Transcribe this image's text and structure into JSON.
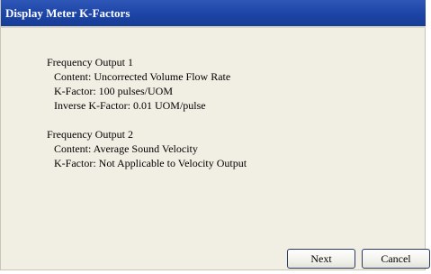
{
  "dialog": {
    "title": "Display Meter K-Factors"
  },
  "outputs": [
    {
      "heading": "Frequency Output 1",
      "lines": [
        "Content: Uncorrected Volume Flow Rate",
        "K-Factor: 100 pulses/UOM",
        "Inverse K-Factor: 0.01 UOM/pulse"
      ]
    },
    {
      "heading": "Frequency Output 2",
      "lines": [
        "Content: Average Sound Velocity",
        "K-Factor: Not Applicable to Velocity Output"
      ]
    }
  ],
  "buttons": {
    "next": "Next",
    "cancel": "Cancel"
  },
  "colors": {
    "titlebar": "#1c44a6",
    "title_text": "#ffffff",
    "dialog_bg": "#f1efe3"
  }
}
